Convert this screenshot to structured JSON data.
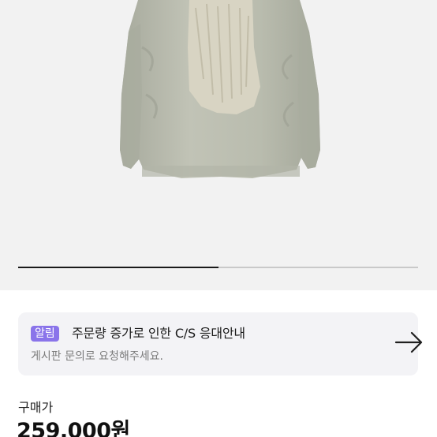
{
  "product": {
    "image_alt": "jacket-photo",
    "carousel_progress": 0.5
  },
  "notice": {
    "badge": "알림",
    "title": "주문량 증가로 인한 C/S 응대안내",
    "subtitle": "게시판 문의로 요청해주세요.",
    "arrow_icon": "arrow-right-icon"
  },
  "price": {
    "label": "구매가",
    "value": "259,000원"
  },
  "colors": {
    "badge": "#8a74ea",
    "card_bg": "#f3f3f6",
    "hero_bg": "#f2f2f2"
  }
}
